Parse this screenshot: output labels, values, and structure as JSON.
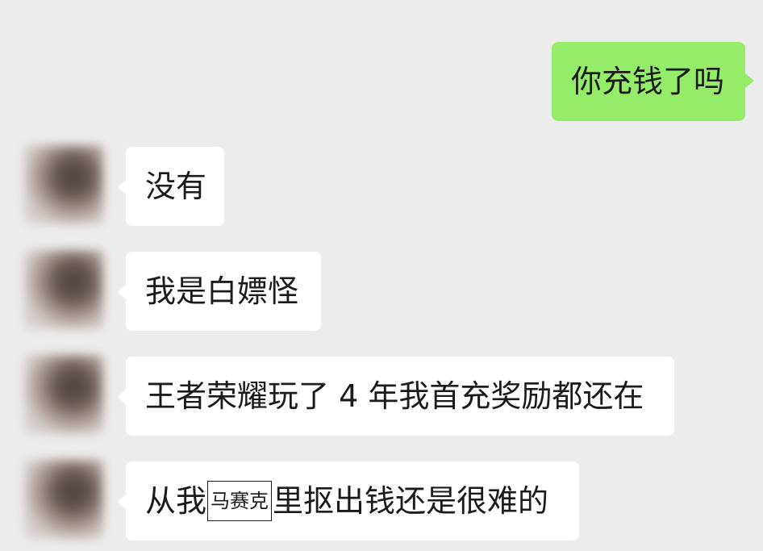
{
  "messages": [
    {
      "side": "out",
      "text": "你充钱了吗"
    },
    {
      "side": "in",
      "text": "没有"
    },
    {
      "side": "in",
      "text": "我是白嫖怪"
    },
    {
      "side": "in",
      "text": "王者荣耀玩了 4 年我首充奖励都还在"
    },
    {
      "side": "in",
      "text_before": "从我",
      "mosaic_label": "马赛克",
      "text_after": "里抠出钱还是很难的"
    }
  ],
  "colors": {
    "background": "#ececec",
    "incoming_bubble": "#ffffff",
    "outgoing_bubble": "#95ec69"
  }
}
